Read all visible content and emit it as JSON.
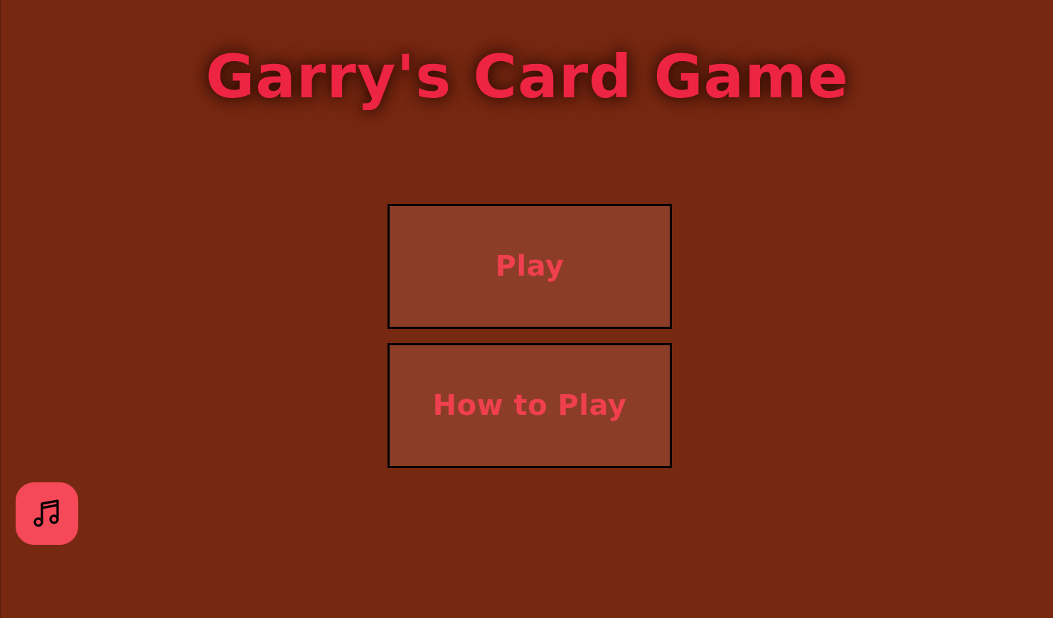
{
  "game": {
    "title": "Garry's Card Game"
  },
  "menu": {
    "play_label": "Play",
    "how_to_play_label": "How to Play"
  },
  "controls": {
    "music_icon": "music-note-icon"
  },
  "colors": {
    "background": "#772811",
    "title_text": "#ee2443",
    "button_fill": "#8b3d28",
    "button_text": "#f0404f",
    "button_border": "#000000",
    "music_button": "#f5495a"
  }
}
